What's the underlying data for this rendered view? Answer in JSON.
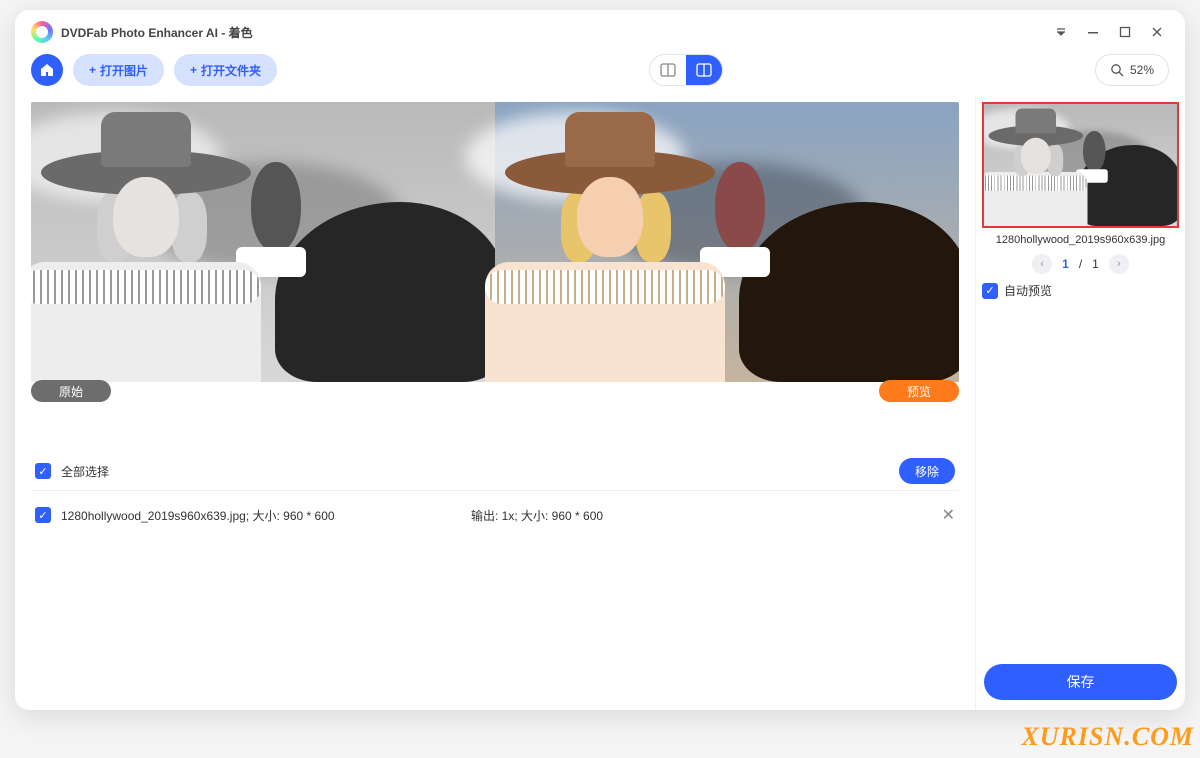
{
  "titlebar": {
    "app_title": "DVDFab Photo Enhancer AI - 着色"
  },
  "toolbar": {
    "open_image": "打开图片",
    "open_folder": "打开文件夹",
    "zoom": "52%"
  },
  "preview": {
    "original_label": "原始",
    "preview_label": "预览"
  },
  "list": {
    "select_all": "全部选择",
    "remove": "移除",
    "rows": [
      {
        "left": "1280hollywood_2019s960x639.jpg; 大小: 960 * 600",
        "mid": "输出: 1x; 大小: 960 * 600"
      }
    ]
  },
  "sidebar": {
    "thumb_caption": "1280hollywood_2019s960x639.jpg",
    "pager_current": "1",
    "pager_sep": "/",
    "pager_total": "1",
    "auto_preview": "自动预览",
    "save": "保存"
  },
  "watermark": "XURISN.COM"
}
